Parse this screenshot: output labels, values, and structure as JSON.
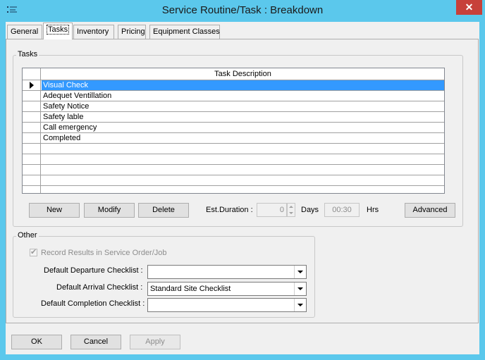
{
  "window": {
    "title": "Service Routine/Task : Breakdown",
    "close_glyph": "✕",
    "app_icon": "list-icon"
  },
  "tabs": [
    {
      "label": "General",
      "active": false
    },
    {
      "label": "Tasks",
      "active": true
    },
    {
      "label": "Inventory",
      "active": false
    },
    {
      "label": "Pricing",
      "active": false
    },
    {
      "label": "Equipment Classes",
      "active": false
    }
  ],
  "tasks_group": {
    "label": "Tasks",
    "column_header": "Task Description",
    "rows": [
      {
        "description": "Visual Check",
        "selected": true
      },
      {
        "description": "Adequet Ventillation",
        "selected": false
      },
      {
        "description": "Safety Notice",
        "selected": false
      },
      {
        "description": "Safety lable",
        "selected": false
      },
      {
        "description": "Call emergency",
        "selected": false
      },
      {
        "description": "Completed",
        "selected": false
      },
      {
        "description": "",
        "selected": false
      },
      {
        "description": "",
        "selected": false
      },
      {
        "description": "",
        "selected": false
      },
      {
        "description": "",
        "selected": false
      }
    ],
    "buttons": {
      "new": "New",
      "modify": "Modify",
      "delete": "Delete",
      "advanced": "Advanced"
    },
    "est_duration_label": "Est.Duration :",
    "days_value": "0",
    "days_label": "Days",
    "hours_value": "00:30",
    "hours_label": "Hrs"
  },
  "other_group": {
    "label": "Other",
    "record_results_label": "Record Results in Service Order/Job",
    "record_results_checked": true,
    "departure_label": "Default Departure Checklist :",
    "departure_value": "",
    "arrival_label": "Default Arrival Checklist :",
    "arrival_value": "Standard Site Checklist",
    "completion_label": "Default Completion Checklist :",
    "completion_value": ""
  },
  "footer": {
    "ok": "OK",
    "cancel": "Cancel",
    "apply": "Apply"
  },
  "colors": {
    "title_bar": "#5bc8ec",
    "close_button": "#c7403a",
    "selection": "#3399ff"
  }
}
